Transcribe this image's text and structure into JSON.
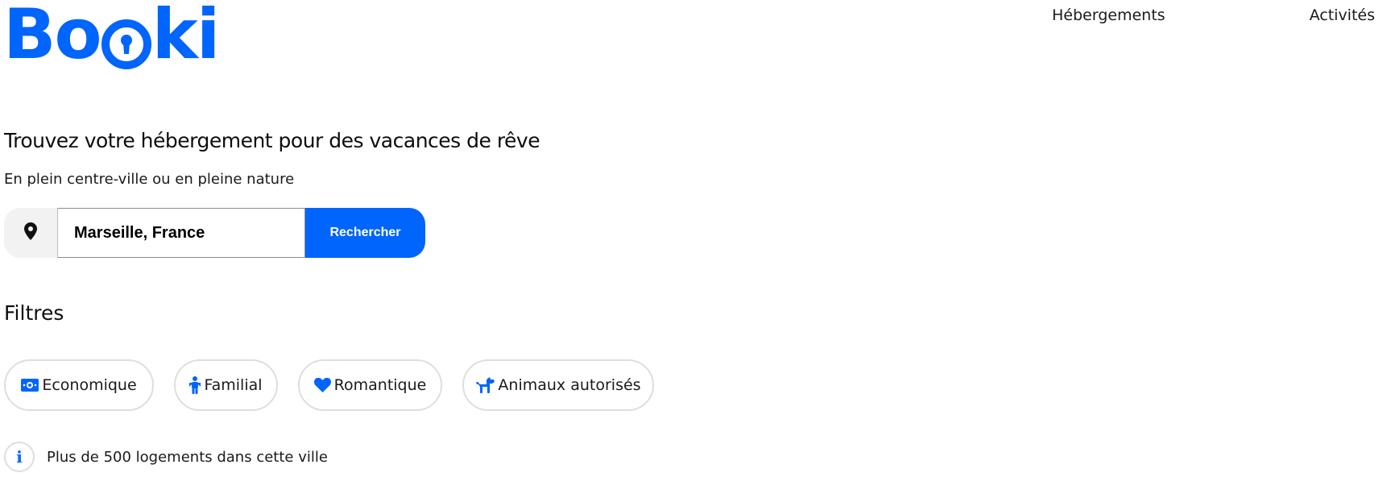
{
  "brand": {
    "logo_prefix": "Bo",
    "logo_suffix": "ki",
    "logo_icon": "keyhole-icon",
    "color": "#0065fc"
  },
  "nav": {
    "items": [
      {
        "label": "Hébergements"
      },
      {
        "label": "Activités"
      }
    ]
  },
  "hero": {
    "title": "Trouvez votre hébergement pour des vacances de rêve",
    "subtitle": "En plein centre-ville ou en pleine nature"
  },
  "search": {
    "icon": "map-pin-icon",
    "value": "Marseille, France",
    "button_label": "Rechercher"
  },
  "filters": {
    "title": "Filtres",
    "items": [
      {
        "label": "Economique",
        "icon": "money-bill-icon"
      },
      {
        "label": "Familial",
        "icon": "child-icon"
      },
      {
        "label": "Romantique",
        "icon": "heart-icon"
      },
      {
        "label": "Animaux autorisés",
        "icon": "dog-icon"
      }
    ]
  },
  "info": {
    "icon": "info-icon",
    "glyph": "i",
    "text": "Plus de 500 logements dans cette ville"
  },
  "colors": {
    "accent": "#0065fc",
    "chip_border": "#dedede",
    "pin_bg": "#f2f2f2"
  }
}
